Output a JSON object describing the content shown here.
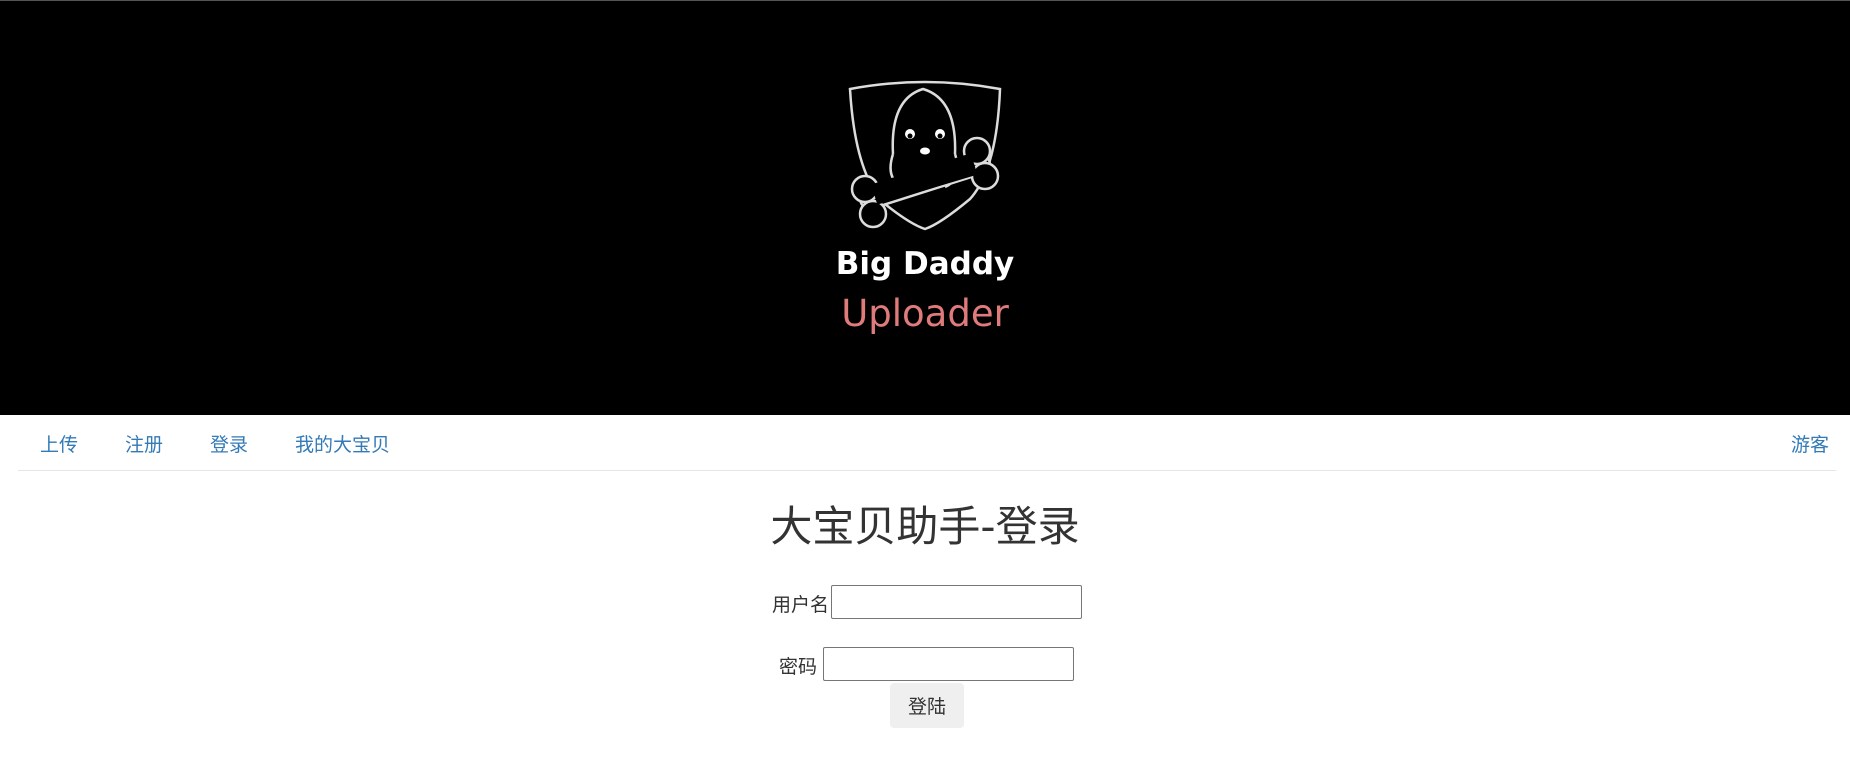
{
  "banner": {
    "logo_title": "Big Daddy",
    "logo_subtitle": "Uploader",
    "logo_icon": "dog-with-bone-shield-icon"
  },
  "nav": {
    "items": [
      {
        "label": "上传"
      },
      {
        "label": "注册"
      },
      {
        "label": "登录"
      },
      {
        "label": "我的大宝贝"
      }
    ],
    "user_label": "游客"
  },
  "main": {
    "title": "大宝贝助手-登录",
    "username_label": "用户名",
    "username_value": "",
    "password_label": "密码",
    "password_value": "",
    "submit_label": "登陆"
  },
  "colors": {
    "banner_bg": "#000000",
    "link": "#337ab7",
    "subtitle": "#e07b7b"
  }
}
